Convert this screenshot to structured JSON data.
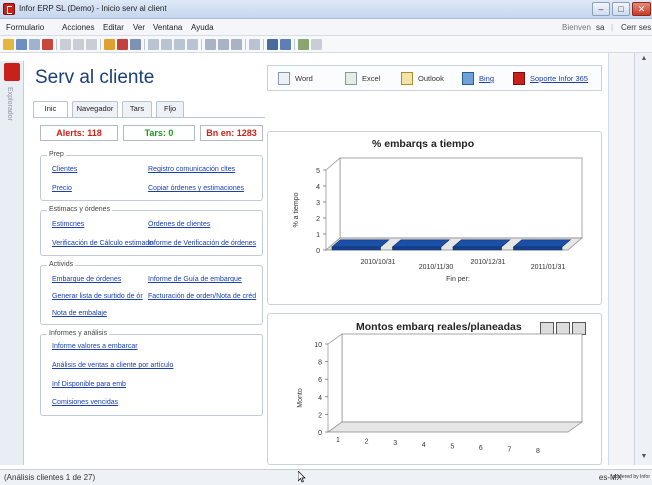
{
  "window": {
    "title": "Infor ERP SL (Demo) - Inicio serv al client",
    "controls": [
      "minimize",
      "maximize",
      "close"
    ]
  },
  "menubar": {
    "items": [
      "Formulario",
      "Acciones",
      "Editar",
      "Ver",
      "Ventana",
      "Ayuda"
    ],
    "greeting": "Bienven",
    "user": "sa",
    "logout": "Cerr ses"
  },
  "left_rail": {
    "label": "Explorador"
  },
  "page": {
    "title": "Serv al cliente"
  },
  "tabs": [
    "Inic",
    "Navegador",
    "Tars",
    "Fljo"
  ],
  "counters": {
    "alerts": "Alerts: 118",
    "tars": "Tars: 0",
    "bn_en": "Bn en: 1283",
    "colors": {
      "alerts": "#d0201a",
      "tars": "#1a9a1a",
      "bn_en": "#d0201a"
    }
  },
  "groups": [
    {
      "label": "Prep",
      "links": [
        "Clientes",
        "Registro comunicación cltes",
        "Precio",
        "Copiar órdenes y estimaciones"
      ]
    },
    {
      "label": "Estimacs y órdenes",
      "links": [
        "Estimcnes",
        "Órdenes de clientes",
        "Verificación de Cálculo estimado",
        "Informe de Verificación de órdenes"
      ]
    },
    {
      "label": "Activids",
      "links": [
        "Embarque de órdenes",
        "Informe de Guía de embarque",
        "Generar lista de surtido de ór",
        "Facturación de orden/Nota de créd",
        "Nota de embalaje"
      ]
    },
    {
      "label": "Informes y análisis",
      "links": [
        "Informe valores a embarcar",
        "Análisis de ventas a cliente por artículo",
        "Inf Disponible para emb",
        "Comisiones vencidas"
      ]
    }
  ],
  "quick_links": [
    {
      "label": "Word",
      "icon": "word-icon",
      "link": false
    },
    {
      "label": "Excel",
      "icon": "excel-icon",
      "link": false
    },
    {
      "label": "Outlook",
      "icon": "outlook-icon",
      "link": false
    },
    {
      "label": "Bing",
      "icon": "bing-icon",
      "link": true
    },
    {
      "label": "Soporte Infor 365",
      "icon": "infor-icon",
      "link": true
    }
  ],
  "chart_data": [
    {
      "type": "bar",
      "title": "% embarqs a tiempo",
      "xlabel": "Fin per:",
      "ylabel": "% a tiempo",
      "categories": [
        "2010/10/31",
        "2010/11/30",
        "2010/12/31",
        "2011/01/31"
      ],
      "values": [
        0,
        0,
        0,
        0
      ],
      "ylim": [
        0,
        5
      ],
      "yticks": [
        0,
        1,
        2,
        3,
        4,
        5
      ],
      "bar_color": "#1c4fa8"
    },
    {
      "type": "line",
      "title": "Montos embarq reales/planeadas",
      "ylabel": "Monto",
      "x": [
        "1",
        "2",
        "3",
        "4",
        "5",
        "6",
        "7",
        "8"
      ],
      "ylim": [
        0,
        10
      ],
      "yticks": [
        0,
        2,
        4,
        6,
        8,
        10
      ],
      "series": []
    }
  ],
  "statusbar": {
    "left": "(Análisis clientes 1 de 27)",
    "locale": "es-MX",
    "powered": "powered by Infor"
  }
}
